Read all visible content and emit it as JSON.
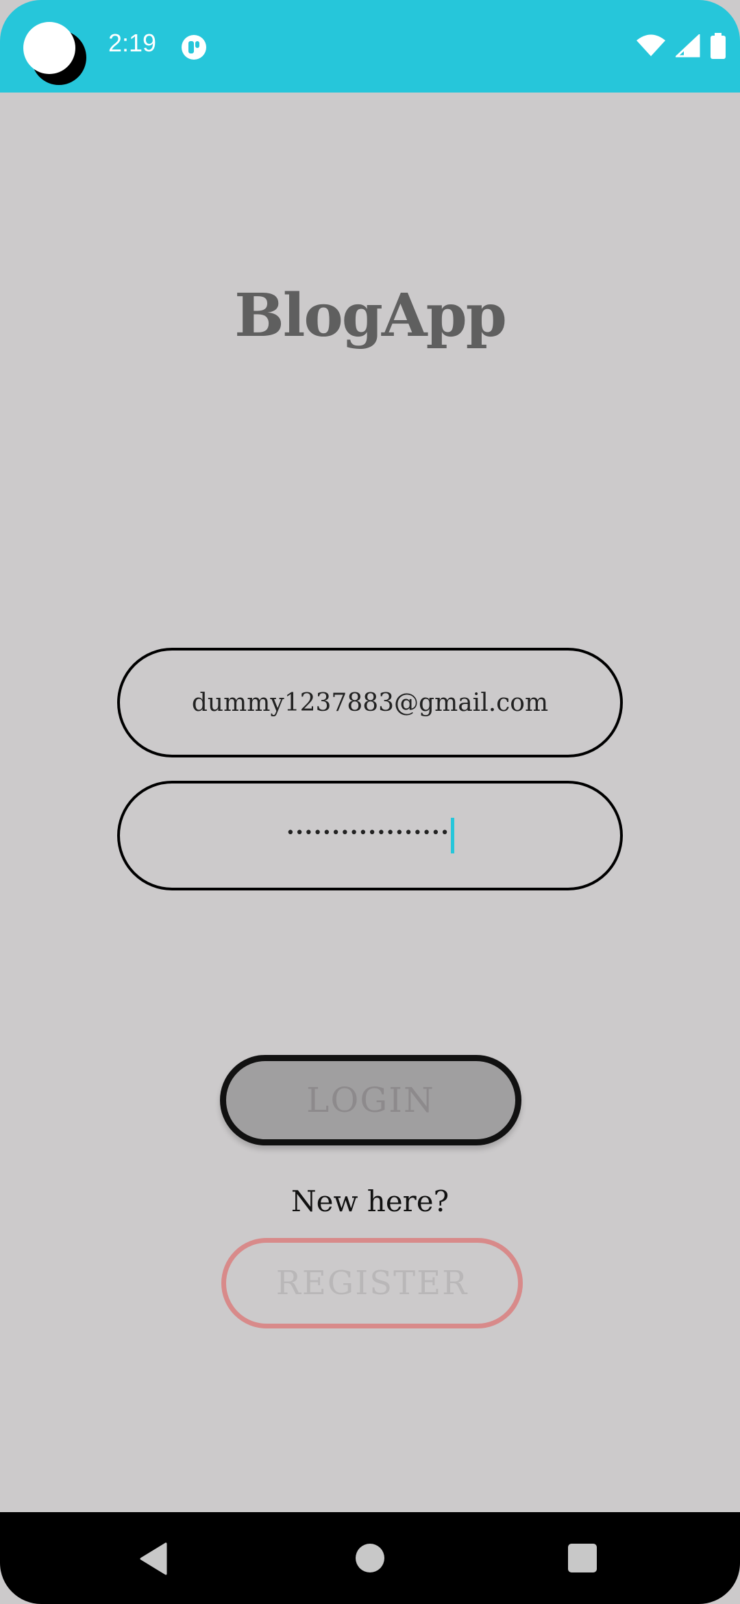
{
  "status_bar": {
    "time": "2:19",
    "background_color": "#26c6da",
    "icons": [
      "notification-icon",
      "wifi-icon",
      "cellular-signal-icon",
      "battery-icon"
    ]
  },
  "app": {
    "title": "BlogApp"
  },
  "login_form": {
    "email_value": "dummy1237883@gmail.com",
    "password_value": "••••••••••••••••••"
  },
  "buttons": {
    "login_label": "LOGIN",
    "new_here_text": "New here?",
    "register_label": "REGISTER"
  },
  "nav_bar": {
    "icons": [
      "back-icon",
      "home-icon",
      "recents-icon"
    ]
  }
}
